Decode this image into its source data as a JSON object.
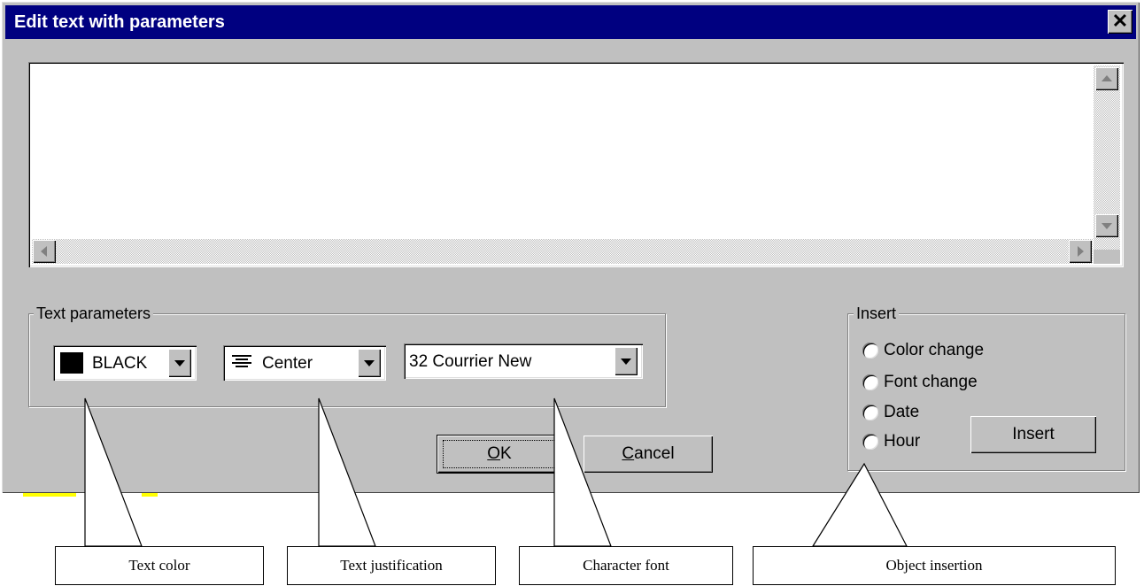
{
  "dialog": {
    "title": "Edit text with parameters",
    "close_glyph": "✕"
  },
  "text_params": {
    "legend": "Text parameters",
    "color": {
      "value": "BLACK",
      "swatch_color": "#000000"
    },
    "justification": {
      "value": "Center",
      "icon": "align-center-icon"
    },
    "font": {
      "value": "32 Courrier New"
    }
  },
  "insert": {
    "legend": "Insert",
    "options": [
      "Color change",
      "Font change",
      "Date",
      "Hour"
    ],
    "button_label": "Insert"
  },
  "buttons": {
    "ok": {
      "accel": "O",
      "rest": "K"
    },
    "cancel": {
      "accel": "C",
      "rest": "ancel"
    }
  },
  "callouts": {
    "text_color": "Text color",
    "text_justification": "Text justification",
    "character_font": "Character font",
    "object_insertion": "Object insertion"
  },
  "colors": {
    "titlebar": "#000080",
    "face": "#c0c0c0"
  }
}
